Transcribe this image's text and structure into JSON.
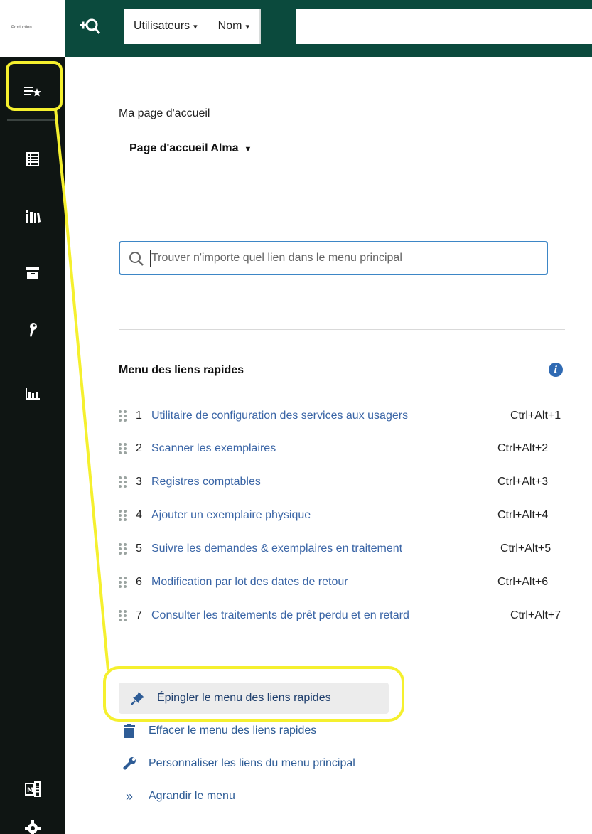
{
  "logo": {
    "text": "Production"
  },
  "topbar": {
    "scope_entity": "Utilisateurs",
    "scope_field": "Nom",
    "caret": "▾"
  },
  "home": {
    "label": "Ma page d'accueil",
    "selected": "Page d'accueil Alma",
    "caret": "▼"
  },
  "menu_search": {
    "placeholder": "Trouver n'importe quel lien dans le menu principal"
  },
  "quick_links": {
    "title": "Menu des liens rapides",
    "info": "i",
    "items": [
      {
        "num": "1",
        "label": "Utilitaire de configuration des services aux usagers",
        "shortcut": "Ctrl+Alt+1"
      },
      {
        "num": "2",
        "label": "Scanner les exemplaires",
        "shortcut": "Ctrl+Alt+2"
      },
      {
        "num": "3",
        "label": "Registres comptables",
        "shortcut": "Ctrl+Alt+3"
      },
      {
        "num": "4",
        "label": "Ajouter un exemplaire physique",
        "shortcut": "Ctrl+Alt+4"
      },
      {
        "num": "5",
        "label": "Suivre les demandes & exemplaires en traitement",
        "shortcut": "Ctrl+Alt+5"
      },
      {
        "num": "6",
        "label": "Modification par lot des dates de retour",
        "shortcut": "Ctrl+Alt+6"
      },
      {
        "num": "7",
        "label": "Consulter les traitements de prêt perdu et en retard",
        "shortcut": "Ctrl+Alt+7"
      }
    ]
  },
  "actions": {
    "pin": "Épingler le menu des liens rapides",
    "clear": "Effacer le menu des liens rapides",
    "customize": "Personnaliser les liens du menu principal",
    "expand": "Agrandir le menu",
    "expand_glyph": "»"
  },
  "colors": {
    "topbar": "#0b4a3d",
    "rail": "#0f1513",
    "link": "#3a65a6",
    "highlight": "#f5f02e",
    "focus_border": "#3d86c6"
  }
}
